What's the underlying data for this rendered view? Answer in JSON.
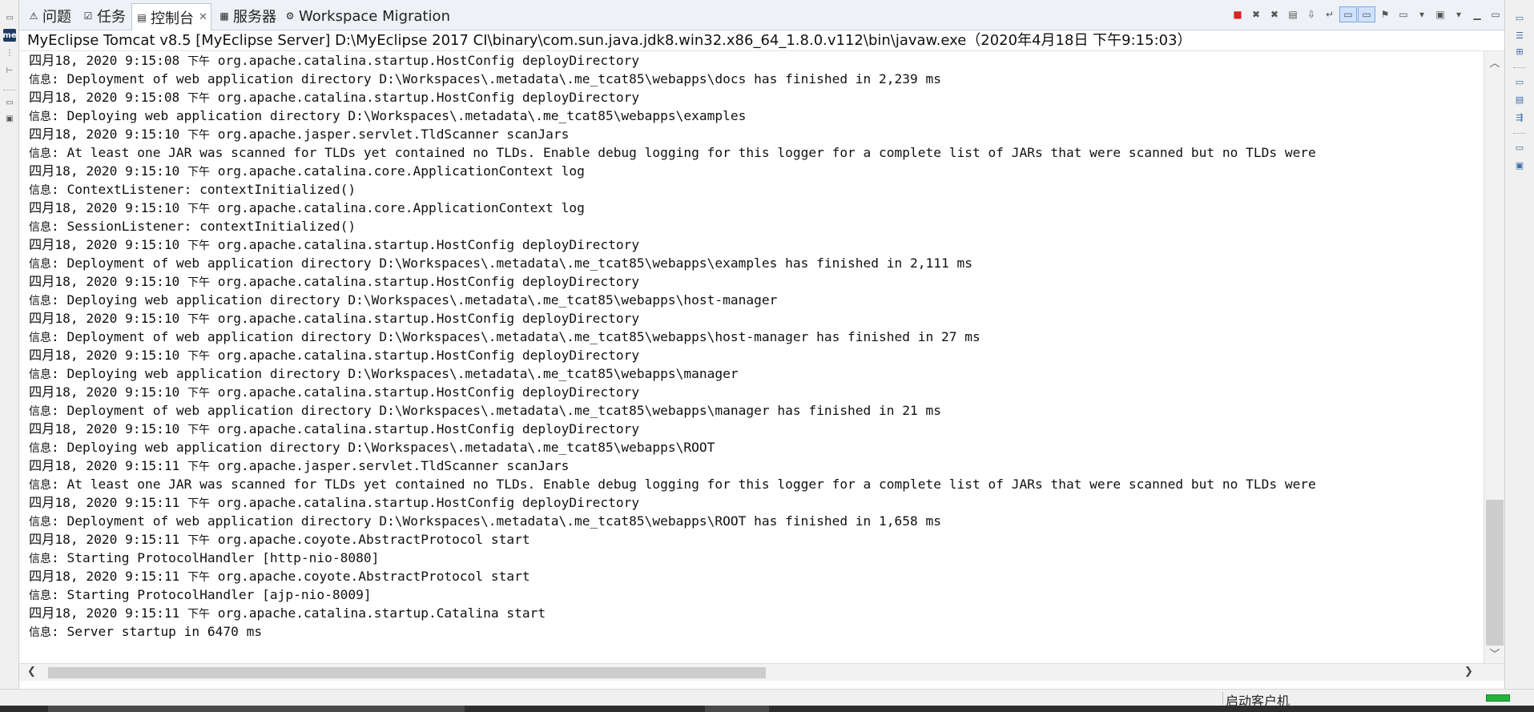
{
  "tabs": [
    {
      "label": "问题",
      "icon": "problems-icon"
    },
    {
      "label": "任务",
      "icon": "tasks-icon"
    },
    {
      "label": "控制台",
      "icon": "console-icon"
    },
    {
      "label": "服务器",
      "icon": "servers-icon"
    },
    {
      "label": "Workspace Migration",
      "icon": "migration-icon"
    }
  ],
  "console_title": "MyEclipse Tomcat v8.5 [MyEclipse Server] D:\\MyEclipse 2017 CI\\binary\\com.sun.java.jdk8.win32.x86_64_1.8.0.v112\\bin\\javaw.exe（2020年4月18日 下午9:15:03）",
  "console_lines": [
    {
      "pre": "四月18, 2020 9:15:08 ",
      "mid": "下午",
      "post": " org.apache.catalina.startup.HostConfig deployDirectory"
    },
    {
      "pre": "信息",
      "mid": "",
      "post": ": Deployment of web application directory D:\\Workspaces\\.metadata\\.me_tcat85\\webapps\\docs has finished in 2,239 ms"
    },
    {
      "pre": "四月18, 2020 9:15:08 ",
      "mid": "下午",
      "post": " org.apache.catalina.startup.HostConfig deployDirectory"
    },
    {
      "pre": "信息",
      "mid": "",
      "post": ": Deploying web application directory D:\\Workspaces\\.metadata\\.me_tcat85\\webapps\\examples"
    },
    {
      "pre": "四月18, 2020 9:15:10 ",
      "mid": "下午",
      "post": " org.apache.jasper.servlet.TldScanner scanJars"
    },
    {
      "pre": "信息",
      "mid": "",
      "post": ": At least one JAR was scanned for TLDs yet contained no TLDs. Enable debug logging for this logger for a complete list of JARs that were scanned but no TLDs were"
    },
    {
      "pre": "四月18, 2020 9:15:10 ",
      "mid": "下午",
      "post": " org.apache.catalina.core.ApplicationContext log"
    },
    {
      "pre": "信息",
      "mid": "",
      "post": ": ContextListener: contextInitialized()"
    },
    {
      "pre": "四月18, 2020 9:15:10 ",
      "mid": "下午",
      "post": " org.apache.catalina.core.ApplicationContext log"
    },
    {
      "pre": "信息",
      "mid": "",
      "post": ": SessionListener: contextInitialized()"
    },
    {
      "pre": "四月18, 2020 9:15:10 ",
      "mid": "下午",
      "post": " org.apache.catalina.startup.HostConfig deployDirectory"
    },
    {
      "pre": "信息",
      "mid": "",
      "post": ": Deployment of web application directory D:\\Workspaces\\.metadata\\.me_tcat85\\webapps\\examples has finished in 2,111 ms"
    },
    {
      "pre": "四月18, 2020 9:15:10 ",
      "mid": "下午",
      "post": " org.apache.catalina.startup.HostConfig deployDirectory"
    },
    {
      "pre": "信息",
      "mid": "",
      "post": ": Deploying web application directory D:\\Workspaces\\.metadata\\.me_tcat85\\webapps\\host-manager"
    },
    {
      "pre": "四月18, 2020 9:15:10 ",
      "mid": "下午",
      "post": " org.apache.catalina.startup.HostConfig deployDirectory"
    },
    {
      "pre": "信息",
      "mid": "",
      "post": ": Deployment of web application directory D:\\Workspaces\\.metadata\\.me_tcat85\\webapps\\host-manager has finished in 27 ms"
    },
    {
      "pre": "四月18, 2020 9:15:10 ",
      "mid": "下午",
      "post": " org.apache.catalina.startup.HostConfig deployDirectory"
    },
    {
      "pre": "信息",
      "mid": "",
      "post": ": Deploying web application directory D:\\Workspaces\\.metadata\\.me_tcat85\\webapps\\manager"
    },
    {
      "pre": "四月18, 2020 9:15:10 ",
      "mid": "下午",
      "post": " org.apache.catalina.startup.HostConfig deployDirectory"
    },
    {
      "pre": "信息",
      "mid": "",
      "post": ": Deployment of web application directory D:\\Workspaces\\.metadata\\.me_tcat85\\webapps\\manager has finished in 21 ms"
    },
    {
      "pre": "四月18, 2020 9:15:10 ",
      "mid": "下午",
      "post": " org.apache.catalina.startup.HostConfig deployDirectory"
    },
    {
      "pre": "信息",
      "mid": "",
      "post": ": Deploying web application directory D:\\Workspaces\\.metadata\\.me_tcat85\\webapps\\ROOT"
    },
    {
      "pre": "四月18, 2020 9:15:11 ",
      "mid": "下午",
      "post": " org.apache.jasper.servlet.TldScanner scanJars"
    },
    {
      "pre": "信息",
      "mid": "",
      "post": ": At least one JAR was scanned for TLDs yet contained no TLDs. Enable debug logging for this logger for a complete list of JARs that were scanned but no TLDs were"
    },
    {
      "pre": "四月18, 2020 9:15:11 ",
      "mid": "下午",
      "post": " org.apache.catalina.startup.HostConfig deployDirectory"
    },
    {
      "pre": "信息",
      "mid": "",
      "post": ": Deployment of web application directory D:\\Workspaces\\.metadata\\.me_tcat85\\webapps\\ROOT has finished in 1,658 ms"
    },
    {
      "pre": "四月18, 2020 9:15:11 ",
      "mid": "下午",
      "post": " org.apache.coyote.AbstractProtocol start"
    },
    {
      "pre": "信息",
      "mid": "",
      "post": ": Starting ProtocolHandler [http-nio-8080]"
    },
    {
      "pre": "四月18, 2020 9:15:11 ",
      "mid": "下午",
      "post": " org.apache.coyote.AbstractProtocol start"
    },
    {
      "pre": "信息",
      "mid": "",
      "post": ": Starting ProtocolHandler [ajp-nio-8009]"
    },
    {
      "pre": "四月18, 2020 9:15:11 ",
      "mid": "下午",
      "post": " org.apache.catalina.startup.Catalina start"
    },
    {
      "pre": "信息",
      "mid": "",
      "post": ": Server startup in 6470 ms"
    }
  ],
  "status": {
    "text": "启动客户机"
  },
  "colors": {
    "stop_red": "#dd2222",
    "progress_green": "#22b33c",
    "tab_bg": "#eef1f6"
  }
}
